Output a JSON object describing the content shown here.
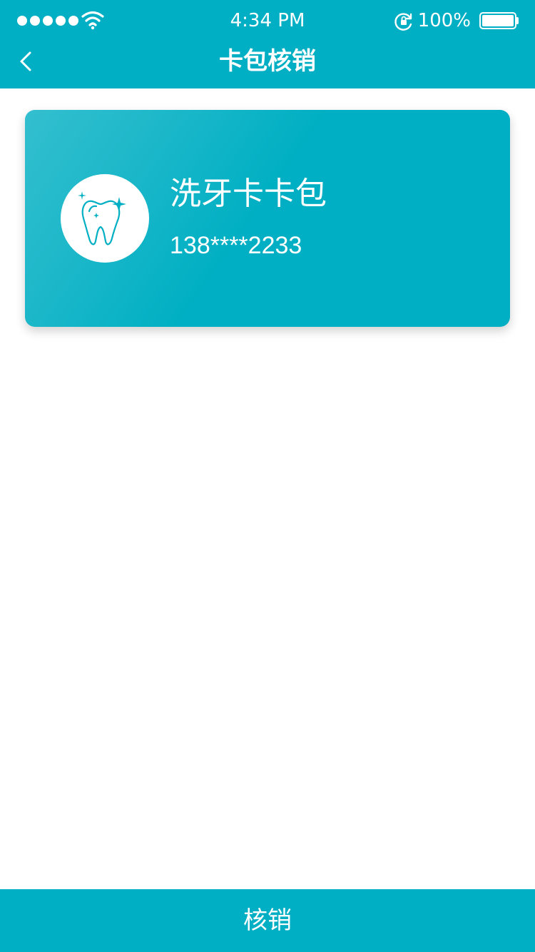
{
  "status_bar": {
    "time": "4:34 PM",
    "battery_percent": "100%",
    "battery_level": 1.0,
    "signal_bars": 5,
    "icons": [
      "signal-dots-icon",
      "wifi-icon",
      "rotation-lock-icon",
      "battery-icon"
    ]
  },
  "nav": {
    "back_icon": "chevron-left-icon",
    "title": "卡包核销"
  },
  "card": {
    "icon": "tooth-sparkle-icon",
    "name": "洗牙卡卡包",
    "phone": "138****2233"
  },
  "actions": {
    "redeem_label": "核销"
  },
  "colors": {
    "primary": "#00AFC3",
    "background": "#FFFFFF",
    "text_on_primary": "#FFFFFF"
  }
}
